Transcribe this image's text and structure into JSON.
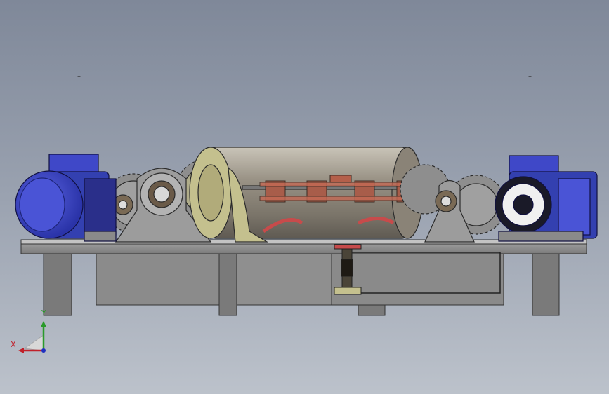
{
  "viewport": {
    "background_top": "#7f8899",
    "background_bottom": "#bcc2cb"
  },
  "triad": {
    "x_label": "X",
    "y_label": "Y",
    "x_color": "#c0202a",
    "y_color": "#2a9a2a",
    "z_color": "#2030c0"
  },
  "markers": {
    "left": "–",
    "right": "–"
  },
  "model": {
    "components": [
      "left-motor",
      "right-motor",
      "left-gear-train",
      "right-gear-train",
      "left-bearing-housing",
      "right-bearing-housing",
      "center-drum",
      "drum-clamp-bands",
      "center-support-column",
      "frame-base",
      "frame-legs"
    ],
    "colors": {
      "motor": "#3f48c8",
      "motor_dark": "#1d2478",
      "frame": "#8d8d8d",
      "drum": "#8a8377",
      "housing": "#c4c08e",
      "clamp": "#a85d4a",
      "red_bar": "#c74b4b"
    }
  }
}
